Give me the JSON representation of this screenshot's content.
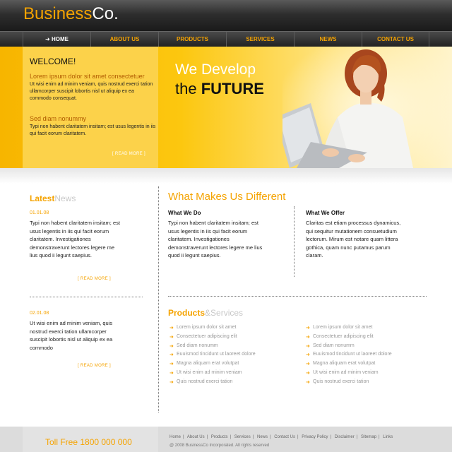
{
  "logo": {
    "part1": "Business",
    "part2": "Co."
  },
  "nav": [
    "HOME",
    "ABOUT US",
    "PRODUCTS",
    "SERVICES",
    "NEWS",
    "CONTACT US"
  ],
  "nav_active_prefix": "➜",
  "welcome": {
    "title": "WELCOME!",
    "heading1": "Lorem ipsum dolor sit amet consectetuer",
    "text1": "Ut wisi enim ad minim veniam, quis nostrud exerci tation ullamcorper suscipit lobortis nisl ut aliquip ex ea commodo consequat.",
    "heading2": "Sed diam nonummy",
    "text2": "Typi non habent claritatem insitam; est usus legentis in iis qui facit eorum claritatem.",
    "more": "[ READ MORE ]"
  },
  "hero": {
    "line1": "We Develop",
    "line2a": "the ",
    "line2b": "FUTURE"
  },
  "news": {
    "title_a": "Latest",
    "title_b": "News",
    "items": [
      {
        "date": "01.01.08",
        "text": "Typi non habent claritatem insitam; est usus legentis in iis qui facit eorum claritatem. Investigationes demonstraverunt lectores legere me lius quod ii legunt saepius.",
        "more": "[ READ MORE ]"
      },
      {
        "date": "02.01.08",
        "text": "Ut wisi enim ad minim veniam, quis nostrud exerci tation ullamcorper suscipit lobortis nisl ut aliquip ex ea commodo",
        "more": "[ READ MORE ]"
      }
    ]
  },
  "different": {
    "title": "What Makes Us Different",
    "col1_h": "What We Do",
    "col1_t": "Typi non habent claritatem insitam; est usus legentis in iis qui facit eorum claritatem. Investigationes demonstraverunt lectores legere me lius quod ii legunt saepius.",
    "col2_h": "What We Offer",
    "col2_t": "Claritas est etiam processus dynamicus, qui sequitur mutationem consuetudium lectorum. Mirum est notare quam littera gothica, quam nunc putamus parum claram."
  },
  "products": {
    "title_a": "Products",
    "title_b": "&Services",
    "list_left": [
      "Lorem ipsum dolor sit amet",
      "Consectetuer adipiscing elit",
      "Sed diam nonumm",
      "Euuismod tincidunt ut laoreet dolore",
      "Magna aliquam erat volutpat",
      "Ut wisi enim ad minim veniam",
      "Quis nostrud exerci tation"
    ],
    "list_right": [
      "Lorem ipsum dolor sit amet",
      "Consectetuer adipiscing elit",
      "Sed diam nonumm",
      "Euuismod tincidunt ut laoreet dolore",
      "Magna aliquam erat volutpat",
      "Ut wisi enim ad minim veniam",
      "Quis nostrud exerci tation"
    ]
  },
  "footer": {
    "tollfree": "Toll Free 1800 000 000",
    "links": [
      "Home",
      "About Us",
      "Products",
      "Services",
      "News",
      "Contact Us",
      "Privacy Policy",
      "Disclaimer",
      "Sitemap",
      "Links"
    ],
    "copyright": "@ 2008 BusinessCo Incorporated. All rights reserved"
  },
  "colors": {
    "accent": "#f5a300",
    "header_dark": "#1a1a1a",
    "hero_yellow": "#fcc70f"
  }
}
